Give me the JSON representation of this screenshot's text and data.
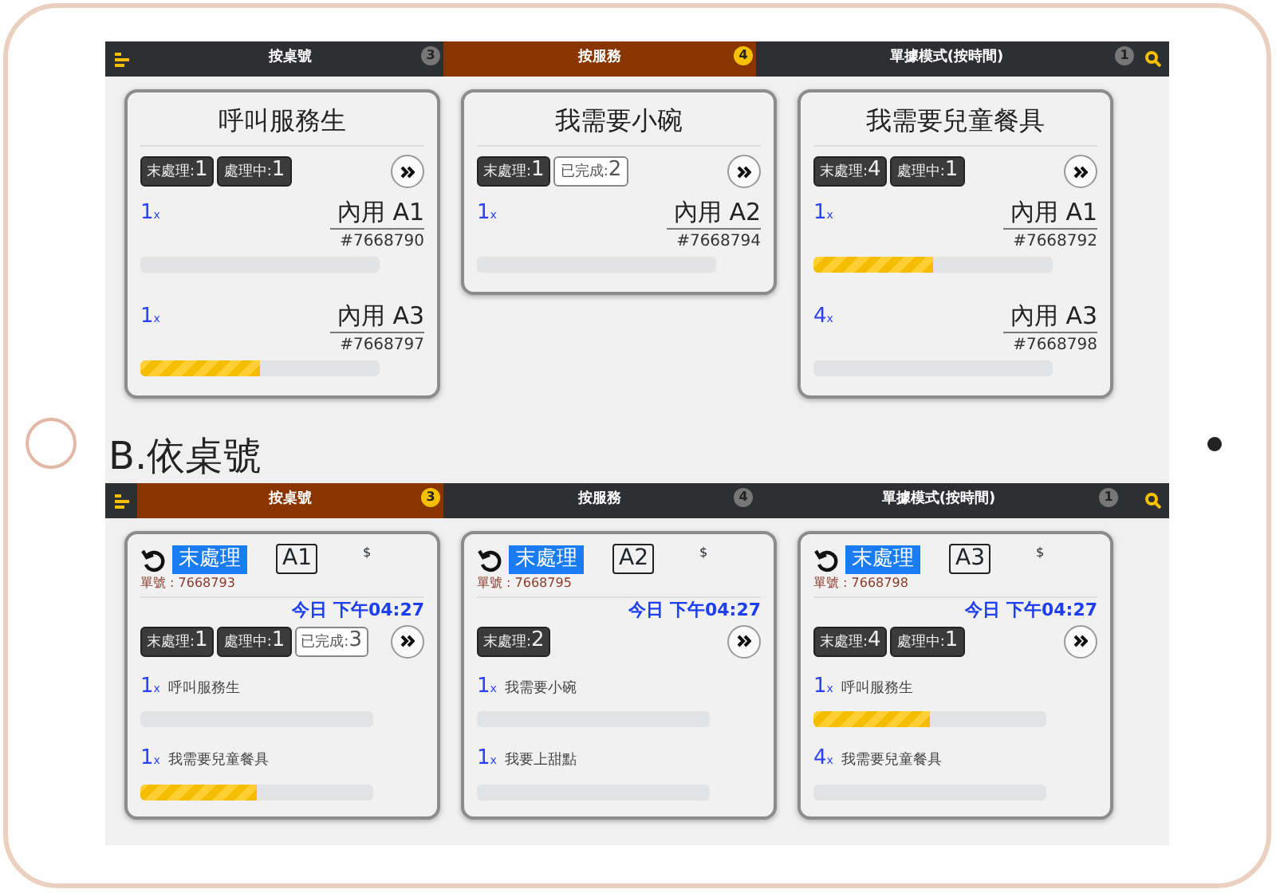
{
  "sections": [
    {
      "tabs": [
        {
          "label": "按桌號",
          "count": "3",
          "selected": false
        },
        {
          "label": "按服務",
          "count": "4",
          "selected": true
        },
        {
          "label": "單據模式(按時間)",
          "count": "1",
          "selected": false
        }
      ],
      "cards": [
        {
          "kind": "service",
          "title": "呼叫服務生",
          "badges": [
            {
              "label": "末處理:",
              "value": "1",
              "kind": "dark"
            },
            {
              "label": "處理中:",
              "value": "1",
              "kind": "dark"
            }
          ],
          "orders": [
            {
              "qty": "1",
              "unit": "x",
              "table": "內用 A1",
              "number": "#7668790",
              "level": 0
            },
            {
              "qty": "1",
              "unit": "x",
              "table": "內用 A3",
              "number": "#7668797",
              "level": 0.5
            }
          ]
        },
        {
          "kind": "service",
          "title": "我需要小碗",
          "badges": [
            {
              "label": "末處理:",
              "value": "1",
              "kind": "dark"
            },
            {
              "label": "已完成:",
              "value": "2",
              "kind": "outline"
            }
          ],
          "orders": [
            {
              "qty": "1",
              "unit": "x",
              "table": "內用 A2",
              "number": "#7668794",
              "level": 0
            }
          ]
        },
        {
          "kind": "service",
          "title": "我需要兒童餐具",
          "badges": [
            {
              "label": "末處理:",
              "value": "4",
              "kind": "dark"
            },
            {
              "label": "處理中:",
              "value": "1",
              "kind": "dark"
            }
          ],
          "orders": [
            {
              "qty": "1",
              "unit": "x",
              "table": "內用 A1",
              "number": "#7668792",
              "level": 0.5
            },
            {
              "qty": "4",
              "unit": "x",
              "table": "內用 A3",
              "number": "#7668798",
              "level": 0
            }
          ]
        }
      ]
    },
    {
      "heading": "B.依桌號",
      "tabs": [
        {
          "label": "按桌號",
          "count": "3",
          "selected": true
        },
        {
          "label": "按服務",
          "count": "4",
          "selected": false
        },
        {
          "label": "單據模式(按時間)",
          "count": "1",
          "selected": false
        }
      ],
      "cards": [
        {
          "kind": "table",
          "status": "末處理",
          "table": "A1",
          "symbol": "$",
          "order_no": "單號 : 7668793",
          "time": "今日 下午04:27",
          "badges": [
            {
              "label": "末處理:",
              "value": "1",
              "kind": "dark"
            },
            {
              "label": "處理中:",
              "value": "1",
              "kind": "dark"
            },
            {
              "label": "已完成:",
              "value": "3",
              "kind": "outline"
            }
          ],
          "items": [
            {
              "qty": "1",
              "unit": "x",
              "name": "呼叫服務生",
              "level": 0
            },
            {
              "qty": "1",
              "unit": "x",
              "name": "我需要兒童餐具",
              "level": 0.5
            }
          ]
        },
        {
          "kind": "table",
          "status": "末處理",
          "table": "A2",
          "symbol": "$",
          "order_no": "單號 : 7668795",
          "time": "今日 下午04:27",
          "badges": [
            {
              "label": "末處理:",
              "value": "2",
              "kind": "dark"
            }
          ],
          "items": [
            {
              "qty": "1",
              "unit": "x",
              "name": "我需要小碗",
              "level": 0
            },
            {
              "qty": "1",
              "unit": "x",
              "name": "我要上甜點",
              "level": 0
            }
          ]
        },
        {
          "kind": "table",
          "status": "末處理",
          "table": "A3",
          "symbol": "$",
          "order_no": "單號 : 7668798",
          "time": "今日 下午04:27",
          "badges": [
            {
              "label": "末處理:",
              "value": "4",
              "kind": "dark"
            },
            {
              "label": "處理中:",
              "value": "1",
              "kind": "dark"
            }
          ],
          "items": [
            {
              "qty": "1",
              "unit": "x",
              "name": "呼叫服務生",
              "level": 0.5
            },
            {
              "qty": "4",
              "unit": "x",
              "name": "我需要兒童餐具",
              "level": 0
            }
          ]
        }
      ]
    }
  ]
}
